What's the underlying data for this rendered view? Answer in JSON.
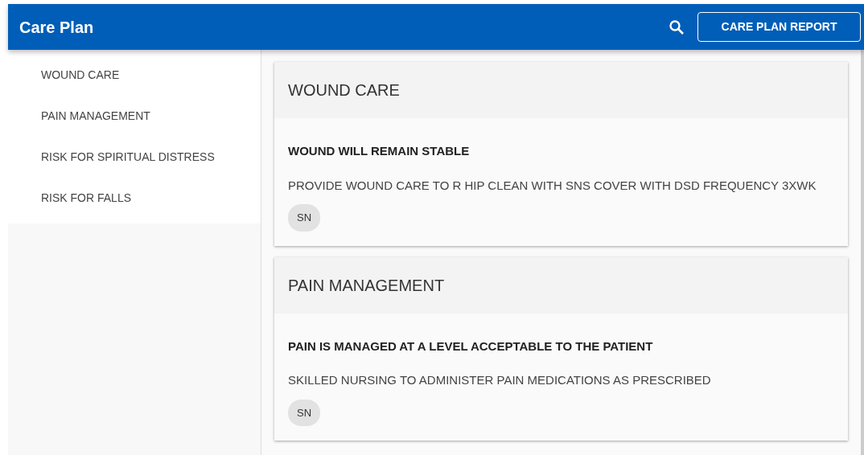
{
  "app_bar": {
    "title": "Care Plan",
    "report_button": "CARE PLAN REPORT"
  },
  "sidebar": {
    "items": [
      {
        "label": "WOUND CARE"
      },
      {
        "label": "PAIN MANAGEMENT"
      },
      {
        "label": "RISK FOR SPIRITUAL DISTRESS"
      },
      {
        "label": "RISK FOR FALLS"
      }
    ]
  },
  "sections": [
    {
      "title": "WOUND CARE",
      "goal": "WOUND WILL REMAIN STABLE",
      "intervention": "PROVIDE WOUND CARE TO R HIP CLEAN WITH SNS COVER WITH DSD FREQUENCY 3XWK",
      "discipline": "SN"
    },
    {
      "title": "PAIN MANAGEMENT",
      "goal": "PAIN IS MANAGED AT A LEVEL ACCEPTABLE TO THE PATIENT",
      "intervention": "SKILLED NURSING TO ADMINISTER PAIN MEDICATIONS AS PRESCRIBED",
      "discipline": "SN"
    }
  ]
}
